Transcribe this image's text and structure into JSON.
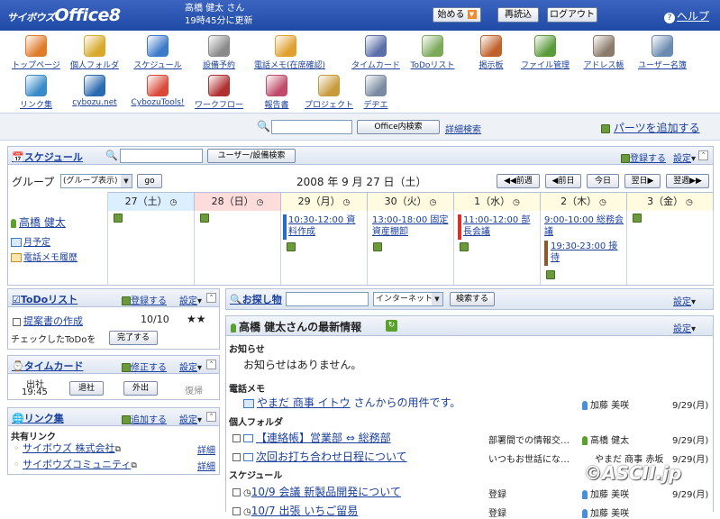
{
  "header": {
    "logo": "サイボウズ",
    "logo_suffix": "Office8",
    "user": "高橋 健太 さん",
    "updated": "19時45分に更新",
    "start_btn": "始める",
    "reload_btn": "再読込",
    "logout_btn": "ログアウト",
    "help": "ヘルプ"
  },
  "apps": [
    {
      "label": "トップページ",
      "icon": "house-icon",
      "color": "#e07b2a"
    },
    {
      "label": "個人フォルダ",
      "icon": "folder-icon",
      "color": "#d9a82b"
    },
    {
      "label": "スケジュール",
      "icon": "calendar-icon",
      "color": "#3b79c9"
    },
    {
      "label": "設備予約",
      "icon": "facility-icon",
      "color": "#8a8a8a"
    },
    {
      "label": "電話メモ(在席確認)",
      "icon": "phone-memo-icon",
      "color": "#e0a030"
    },
    {
      "label": "タイムカード",
      "icon": "timecard-icon",
      "color": "#5a6fa8"
    },
    {
      "label": "ToDoリスト",
      "icon": "todo-icon",
      "color": "#7ca85a"
    },
    {
      "label": "掲示板",
      "icon": "bulletin-icon",
      "color": "#c0602a"
    },
    {
      "label": "ファイル管理",
      "icon": "file-cabinet-icon",
      "color": "#5a9a3a"
    },
    {
      "label": "アドレス帳",
      "icon": "address-book-icon",
      "color": "#8a7a6a"
    },
    {
      "label": "ユーザー名簿",
      "icon": "user-list-icon",
      "color": "#6a8ab0"
    },
    {
      "label": "リンク集",
      "icon": "link-globe-icon",
      "color": "#3a8ac9"
    },
    {
      "label": "cybozu.net",
      "icon": "cybozu-net-icon",
      "color": "#2a6ab0"
    },
    {
      "label": "CybozuTools!",
      "icon": "tools-icon",
      "color": "#d94a3a"
    },
    {
      "label": "ワークフロー",
      "icon": "workflow-icon",
      "color": "#b03030"
    },
    {
      "label": "報告書",
      "icon": "report-icon",
      "color": "#c04a6a"
    },
    {
      "label": "プロジェクト",
      "icon": "project-icon",
      "color": "#c99a3a"
    },
    {
      "label": "デヂエ",
      "icon": "database-icon",
      "color": "#7a8aa0"
    }
  ],
  "search": {
    "office_btn": "Office内検索",
    "detail": "詳細検索",
    "add_parts": "パーツを追加する"
  },
  "schedule": {
    "title": "スケジュール",
    "user_search_btn": "ユーザー/設備検索",
    "register": "登録する",
    "settings": "設定",
    "group_label": "グループ",
    "group_select": "(グループ表示)",
    "go_btn": "go",
    "date_title": "2008 年 9 月 27 日（土）",
    "prev_week": "前週",
    "prev_day": "前日",
    "today": "今日",
    "next_day": "翌日",
    "next_week": "翌週",
    "days": [
      "27（土）",
      "28（日）",
      "29（月）",
      "30（火）",
      "1（水）",
      "2（木）",
      "3（金）"
    ],
    "user_name": "高橋 健太",
    "monthly": "月予定",
    "phone_history": "電話メモ履歴",
    "events": {
      "d29": "10:30-12:00 資料作成",
      "d30": "13:00-18:00 固定資産棚卸",
      "d1": "11:00-12:00 部長会議",
      "d2a": "9:00-10:00 総務会議",
      "d2b": "19:30-23:00 接待"
    }
  },
  "todo": {
    "title": "ToDoリスト",
    "register": "登録する",
    "settings": "設定",
    "item": "提案書の作成",
    "date": "10/10",
    "stars": "★★",
    "note": "チェックしたToDoを",
    "done_btn": "完了する"
  },
  "timecard": {
    "title": "タイムカード",
    "edit": "修正する",
    "settings": "設定",
    "in_label": "出社",
    "in_time": "19:45",
    "out_btn": "退社",
    "away_btn": "外出",
    "return_lbl": "復帰"
  },
  "links": {
    "title": "リンク集",
    "add": "追加する",
    "settings": "設定",
    "shared": "共有リンク",
    "l1": "サイボウズ 株式会社",
    "l2": "サイボウズコミュニティ",
    "detail": "詳細"
  },
  "find": {
    "title": "お探し物",
    "scope": "インターネット",
    "search_btn": "検索する",
    "settings": "設定"
  },
  "latest": {
    "title": "高橋 健太さんの最新情報",
    "settings": "設定",
    "notice_h": "お知らせ",
    "notice_txt": "お知らせはありません。",
    "memo_h": "電話メモ",
    "memo_from": "やまだ 商事 イトウ",
    "memo_rest": "さんからの用件です。",
    "memo_user": "加藤 美咲",
    "memo_date": "9/29(月)",
    "folder_h": "個人フォルダ",
    "f1": "【連絡帳】営業部 ⇔ 総務部",
    "f1_sum": "部署間での情報交…",
    "f1_user": "高橋 健太",
    "f1_date": "9/29(月)",
    "f2": "次回お打ち合わせ日程について",
    "f2_sum": "いつもお世話にな…",
    "f2_user": "やまだ 商事 赤坂",
    "f2_date": "9/29(月)",
    "sched_h": "スケジュール",
    "s1": "10/9 会議 新製品開発について",
    "s1_sum": "登録",
    "s1_user": "加藤 美咲",
    "s1_date": "9/29(月)",
    "s2": "10/7 出張 いちご留易",
    "s2_sum": "登録",
    "s2_user": "加藤 美咲"
  },
  "watermark": "©ASCII.jp"
}
